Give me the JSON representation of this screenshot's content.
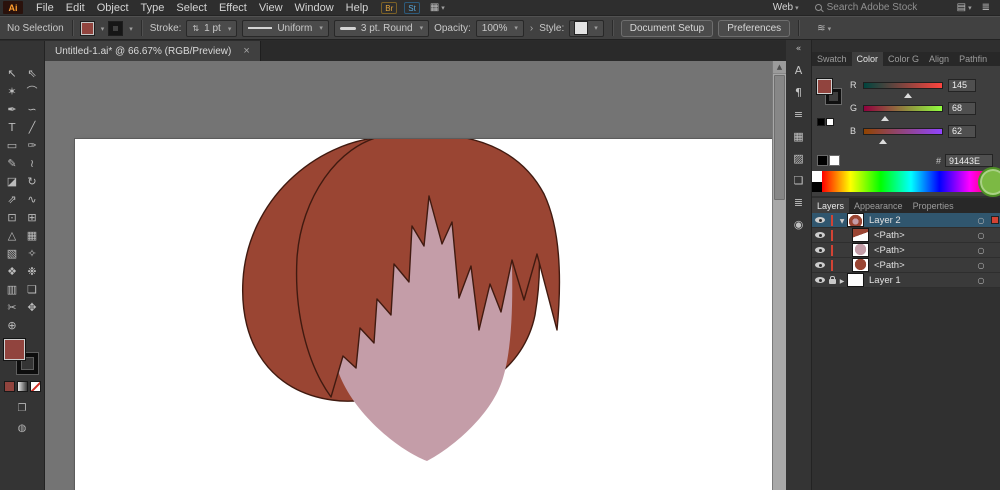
{
  "app": {
    "logo": "Ai"
  },
  "menubar": {
    "items": [
      "File",
      "Edit",
      "Object",
      "Type",
      "Select",
      "Effect",
      "View",
      "Window",
      "Help"
    ],
    "bridge": "Br",
    "stock": "St",
    "workspace": "Web",
    "search_placeholder": "Search Adobe Stock"
  },
  "controlbar": {
    "selection": "No Selection",
    "stroke_label": "Stroke:",
    "stroke_value": "1 pt",
    "profile": "Uniform",
    "brush": "3 pt. Round",
    "opacity_label": "Opacity:",
    "opacity_value": "100%",
    "style_label": "Style:",
    "doc_setup": "Document Setup",
    "preferences": "Preferences"
  },
  "document_tab": {
    "title": "Untitled-1.ai* @ 66.67% (RGB/Preview)",
    "close": "×"
  },
  "tools": [
    {
      "name": "selection",
      "glyph": "↖"
    },
    {
      "name": "direct-selection",
      "glyph": "⇖"
    },
    {
      "name": "magic-wand",
      "glyph": "✶"
    },
    {
      "name": "lasso",
      "glyph": "⌒"
    },
    {
      "name": "pen",
      "glyph": "✒"
    },
    {
      "name": "curvature",
      "glyph": "∽"
    },
    {
      "name": "type",
      "glyph": "T"
    },
    {
      "name": "line-segment",
      "glyph": "╱"
    },
    {
      "name": "rectangle",
      "glyph": "▭"
    },
    {
      "name": "paintbrush",
      "glyph": "✑"
    },
    {
      "name": "pencil",
      "glyph": "✎"
    },
    {
      "name": "shaper",
      "glyph": "≀"
    },
    {
      "name": "eraser",
      "glyph": "◪"
    },
    {
      "name": "rotate",
      "glyph": "↻"
    },
    {
      "name": "scale",
      "glyph": "⇗"
    },
    {
      "name": "width",
      "glyph": "∿"
    },
    {
      "name": "free-transform",
      "glyph": "⊡"
    },
    {
      "name": "shape-builder",
      "glyph": "⊞"
    },
    {
      "name": "perspective-grid",
      "glyph": "△"
    },
    {
      "name": "mesh",
      "glyph": "▦"
    },
    {
      "name": "gradient",
      "glyph": "▧"
    },
    {
      "name": "eyedropper",
      "glyph": "✧"
    },
    {
      "name": "blend",
      "glyph": "❖"
    },
    {
      "name": "symbol-sprayer",
      "glyph": "❉"
    },
    {
      "name": "column-graph",
      "glyph": "▥"
    },
    {
      "name": "artboard",
      "glyph": "❏"
    },
    {
      "name": "slice",
      "glyph": "✂"
    },
    {
      "name": "hand",
      "glyph": "✥"
    },
    {
      "name": "zoom",
      "glyph": "⊕"
    }
  ],
  "panel_strip": {
    "collapse": "«",
    "icons": [
      {
        "name": "character",
        "glyph": "A"
      },
      {
        "name": "paragraph",
        "glyph": "¶"
      },
      {
        "name": "stroke",
        "glyph": "≡"
      },
      {
        "name": "swatches",
        "glyph": "▦"
      },
      {
        "name": "transparency",
        "glyph": "▨"
      },
      {
        "name": "artboards",
        "glyph": "❏"
      },
      {
        "name": "appearance",
        "glyph": "≣"
      },
      {
        "name": "graphic-styles",
        "glyph": "◉"
      }
    ]
  },
  "color_panel": {
    "tabs": [
      "Swatch",
      "Color",
      "Color G",
      "Align",
      "Pathfin"
    ],
    "channels": [
      {
        "label": "R",
        "value": "145"
      },
      {
        "label": "G",
        "value": "68"
      },
      {
        "label": "B",
        "value": "62"
      }
    ],
    "hex_label": "#",
    "hex": "91443E",
    "fill": "#91443E"
  },
  "layers_panel": {
    "tabs": [
      "Layers",
      "Appearance",
      "Properties"
    ],
    "rows": [
      {
        "label": "Layer 2"
      },
      {
        "label": "<Path>"
      },
      {
        "label": "<Path>"
      },
      {
        "label": "<Path>"
      },
      {
        "label": "Layer 1"
      }
    ]
  },
  "artwork": {
    "hair_fill": "#9A4533",
    "hair_outline": "#401A10",
    "face_fill": "#C49DA8"
  },
  "ui_colors": {
    "layer_accent": "#D24334",
    "green_badge": "#7CB944",
    "selected_row": "#30566E"
  }
}
